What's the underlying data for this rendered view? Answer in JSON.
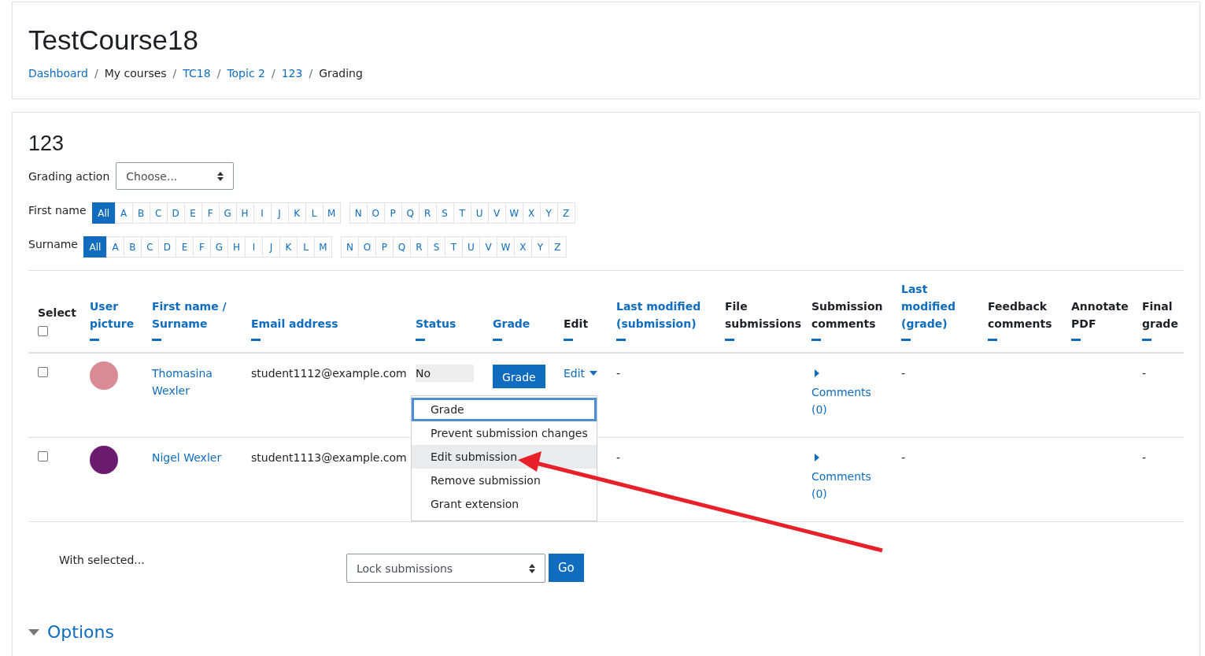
{
  "course_header": {
    "title": "TestCourse18",
    "breadcrumb": [
      {
        "label": "Dashboard",
        "link": true
      },
      {
        "separator": "/",
        "label": "My courses",
        "link": false
      },
      {
        "separator": "/",
        "label": "TC18",
        "link": true
      },
      {
        "separator": "/",
        "label": "Topic 2",
        "link": true
      },
      {
        "separator": "/",
        "label": "123",
        "link": true
      },
      {
        "separator": "/",
        "label": "Grading",
        "link": false
      }
    ]
  },
  "assignment": {
    "title": "123",
    "grading_action": {
      "label": "Grading action",
      "value": "Choose..."
    }
  },
  "filters": [
    {
      "label": "First name",
      "groups": [
        [
          {
            "label": "All",
            "selected": true
          },
          {
            "label": "A",
            "selected": false
          },
          {
            "label": "B",
            "selected": false
          },
          {
            "label": "C",
            "selected": false
          },
          {
            "label": "D",
            "selected": false
          },
          {
            "label": "E",
            "selected": false
          },
          {
            "label": "F",
            "selected": false
          },
          {
            "label": "G",
            "selected": false
          },
          {
            "label": "H",
            "selected": false
          },
          {
            "label": "I",
            "selected": false
          },
          {
            "label": "J",
            "selected": false
          },
          {
            "label": "K",
            "selected": false
          },
          {
            "label": "L",
            "selected": false
          },
          {
            "label": "M",
            "selected": false
          }
        ],
        [
          {
            "label": "N",
            "selected": false
          },
          {
            "label": "O",
            "selected": false
          },
          {
            "label": "P",
            "selected": false
          },
          {
            "label": "Q",
            "selected": false
          },
          {
            "label": "R",
            "selected": false
          },
          {
            "label": "S",
            "selected": false
          },
          {
            "label": "T",
            "selected": false
          },
          {
            "label": "U",
            "selected": false
          },
          {
            "label": "V",
            "selected": false
          },
          {
            "label": "W",
            "selected": false
          },
          {
            "label": "X",
            "selected": false
          },
          {
            "label": "Y",
            "selected": false
          },
          {
            "label": "Z",
            "selected": false
          }
        ]
      ]
    },
    {
      "label": "Surname",
      "groups": [
        [
          {
            "label": "All",
            "selected": true
          },
          {
            "label": "A",
            "selected": false
          },
          {
            "label": "B",
            "selected": false
          },
          {
            "label": "C",
            "selected": false
          },
          {
            "label": "D",
            "selected": false
          },
          {
            "label": "E",
            "selected": false
          },
          {
            "label": "F",
            "selected": false
          },
          {
            "label": "G",
            "selected": false
          },
          {
            "label": "H",
            "selected": false
          },
          {
            "label": "I",
            "selected": false
          },
          {
            "label": "J",
            "selected": false
          },
          {
            "label": "K",
            "selected": false
          },
          {
            "label": "L",
            "selected": false
          },
          {
            "label": "M",
            "selected": false
          }
        ],
        [
          {
            "label": "N",
            "selected": false
          },
          {
            "label": "O",
            "selected": false
          },
          {
            "label": "P",
            "selected": false
          },
          {
            "label": "Q",
            "selected": false
          },
          {
            "label": "R",
            "selected": false
          },
          {
            "label": "S",
            "selected": false
          },
          {
            "label": "T",
            "selected": false
          },
          {
            "label": "U",
            "selected": false
          },
          {
            "label": "V",
            "selected": false
          },
          {
            "label": "W",
            "selected": false
          },
          {
            "label": "X",
            "selected": false
          },
          {
            "label": "Y",
            "selected": false
          },
          {
            "label": "Z",
            "selected": false
          }
        ]
      ]
    }
  ],
  "table": {
    "columns": [
      {
        "label": "Select",
        "kind": "select",
        "checked": false
      },
      {
        "label": "User picture",
        "kind": "sortable"
      },
      {
        "label": "First name / Surname",
        "kind": "sortable"
      },
      {
        "label": "Email address",
        "kind": "sortable"
      },
      {
        "label": "Status",
        "kind": "sortable"
      },
      {
        "label": "Grade",
        "kind": "sortable"
      },
      {
        "label": "Edit",
        "kind": "plain"
      },
      {
        "label": "Last modified (submission)",
        "kind": "sortable"
      },
      {
        "label": "File submissions",
        "kind": "plain"
      },
      {
        "label": "Submission comments",
        "kind": "plain"
      },
      {
        "label": "Last modified (grade)",
        "kind": "sortable"
      },
      {
        "label": "Feedback comments",
        "kind": "plain"
      },
      {
        "label": "Annotate PDF",
        "kind": "plain"
      },
      {
        "label": "Final grade",
        "kind": "plain"
      }
    ],
    "rows": [
      {
        "checked": false,
        "name": "Thomasina Wexler",
        "email": "student1112@example.com",
        "status": "No",
        "grade_button": "Grade",
        "edit": "Edit",
        "last_modified": "-",
        "comments": "Comments (0)",
        "last_modified_grade": "-",
        "final_grade": "-"
      },
      {
        "checked": false,
        "name": "Nigel Wexler",
        "email": "student1113@example.com",
        "last_modified": "-",
        "comments": "Comments (0)",
        "last_modified_grade": "-",
        "final_grade": "-"
      }
    ]
  },
  "edit_menu": [
    {
      "label": "Grade",
      "focused": true,
      "hovered": false
    },
    {
      "label": "Prevent submission changes",
      "focused": false,
      "hovered": false
    },
    {
      "label": "Edit submission",
      "focused": false,
      "hovered": true
    },
    {
      "label": "Remove submission",
      "focused": false,
      "hovered": false
    },
    {
      "label": "Grant extension",
      "focused": false,
      "hovered": false
    }
  ],
  "bulk_action": {
    "label": "With selected...",
    "value": "Lock submissions",
    "button": "Go"
  },
  "options": {
    "label": "Options"
  }
}
